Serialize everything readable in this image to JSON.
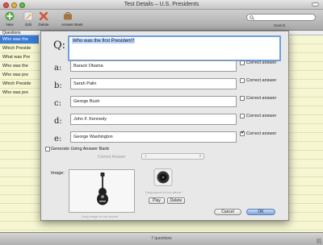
{
  "window": {
    "title": "Test Details – U.S. Presidents"
  },
  "toolbar": {
    "buttons": [
      {
        "label": "New",
        "icon": "plus-icon"
      },
      {
        "label": "Edit",
        "icon": "pencil-icon"
      },
      {
        "label": "Delete",
        "icon": "x-icon"
      },
      {
        "label": "Answer Bank",
        "icon": "briefcase-icon"
      }
    ],
    "search_label": "Search",
    "search_placeholder": ""
  },
  "list": {
    "header": "Questions",
    "rows": [
      {
        "text": "Who was the"
      },
      {
        "text": "Which Preside"
      },
      {
        "text": "What was Pre"
      },
      {
        "text": "Who was the"
      },
      {
        "text": "Who was pre"
      },
      {
        "text": "Which Preside"
      },
      {
        "text": "Who was pre"
      }
    ]
  },
  "status": {
    "text": "7 questions"
  },
  "sheet": {
    "question_glyph": "Q:",
    "question_text": "Who was the first President?",
    "answers": [
      {
        "letter": "a:",
        "text": "Barack Obama",
        "correct": false
      },
      {
        "letter": "b:",
        "text": "Sarah Palin",
        "correct": false
      },
      {
        "letter": "c:",
        "text": "George Bush",
        "correct": false
      },
      {
        "letter": "d:",
        "text": "John F. Kennedy",
        "correct": false
      },
      {
        "letter": "e:",
        "text": "George Washington",
        "correct": true
      }
    ],
    "correct_answer_label": "Correct answer",
    "generate_label": "Generate Using Answer Bank",
    "generate_checked": false,
    "correct_answer_field_label": "Correct Answer:",
    "correct_answer_value": "7",
    "image_label": "Image:",
    "image_hint": "Drag image or box above",
    "sound_hint": "Drag sound to box above",
    "play_label": "Play",
    "delete_label": "Delete",
    "cancel_label": "Cancel",
    "ok_label": "OK"
  },
  "colors": {
    "selection": "#3a7bd5",
    "list_row": "#f6f6d2",
    "focus_ring": "#6e9fe0"
  }
}
